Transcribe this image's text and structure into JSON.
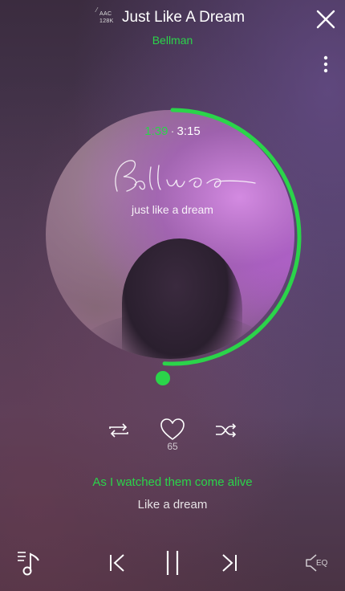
{
  "header": {
    "codec_format": "AAC",
    "codec_bitrate": "128K",
    "title": "Just Like A Dream",
    "artist": "Bellman",
    "close_icon": "close-icon",
    "more_icon": "more-vertical-icon"
  },
  "artwork": {
    "time_current": "1:39",
    "time_separator": "·",
    "time_total": "3:15",
    "caption": "just like a dream",
    "progress_fraction": 0.51
  },
  "actions": {
    "repeat_icon": "repeat-icon",
    "like_icon": "heart-icon",
    "like_count": "65",
    "shuffle_icon": "shuffle-icon"
  },
  "lyrics": {
    "current": "As I watched them come alive",
    "next": "Like a dream"
  },
  "controls": {
    "playlist_icon": "playlist-music-icon",
    "prev_icon": "skip-previous-icon",
    "pause_icon": "pause-icon",
    "next_icon": "skip-next-icon",
    "eq_label": "EQ"
  },
  "colors": {
    "accent": "#2bd44a",
    "text": "#ffffff"
  }
}
